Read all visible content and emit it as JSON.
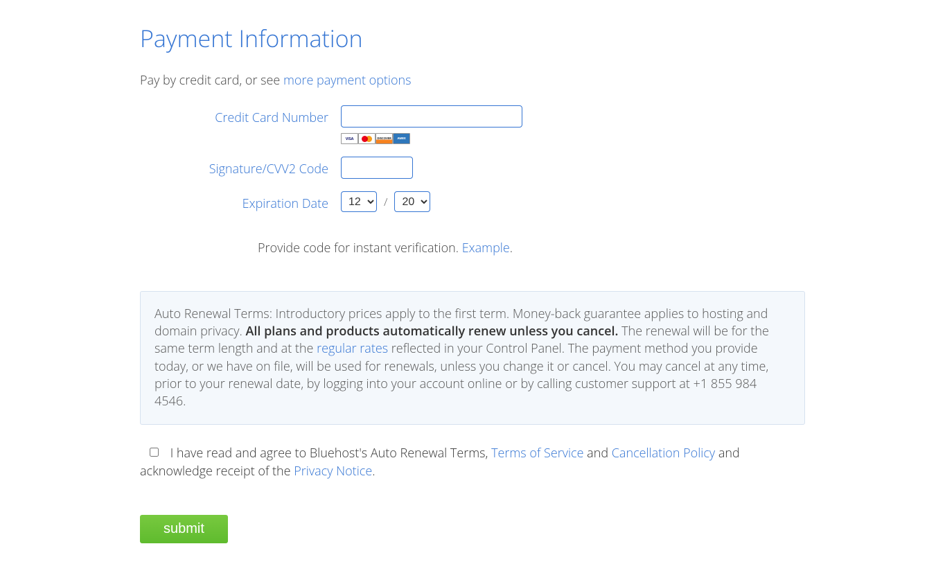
{
  "title": "Payment Information",
  "intro": {
    "prefix": "Pay by credit card, or see ",
    "link": "more payment options"
  },
  "fields": {
    "cc_label": "Credit Card Number",
    "cvv_label": "Signature/CVV2 Code",
    "exp_label": "Expiration Date",
    "exp_month": "12",
    "exp_year": "20",
    "slash": "/"
  },
  "card_brands": {
    "visa": "VISA",
    "discover": "DISCOVER",
    "amex": "AMEX"
  },
  "verify": {
    "text": "Provide code for instant verification. ",
    "link": "Example",
    "suffix": "."
  },
  "terms": {
    "p1": "Auto Renewal Terms: Introductory prices apply to the first term. Money-back guarantee applies to hosting and domain privacy. ",
    "bold": "All plans and products automatically renew unless you cancel.",
    "p2": " The renewal will be for the same term length and at the ",
    "rates_link": "regular rates",
    "p3": " reflected in your Control Panel. The payment method you provide today, or we have on file, will be used for renewals, unless you change it or cancel. You may cancel at any time, prior to your renewal date, by logging into your account online or by calling customer support at +1 855 984 4546."
  },
  "agree": {
    "a": "I have read and agree to Bluehost's Auto Renewal Terms, ",
    "tos": "Terms of Service",
    "b": " and ",
    "cancel": "Cancellation Policy",
    "c": " and acknowledge receipt of the ",
    "privacy": "Privacy Notice",
    "d": "."
  },
  "submit_label": "submit"
}
